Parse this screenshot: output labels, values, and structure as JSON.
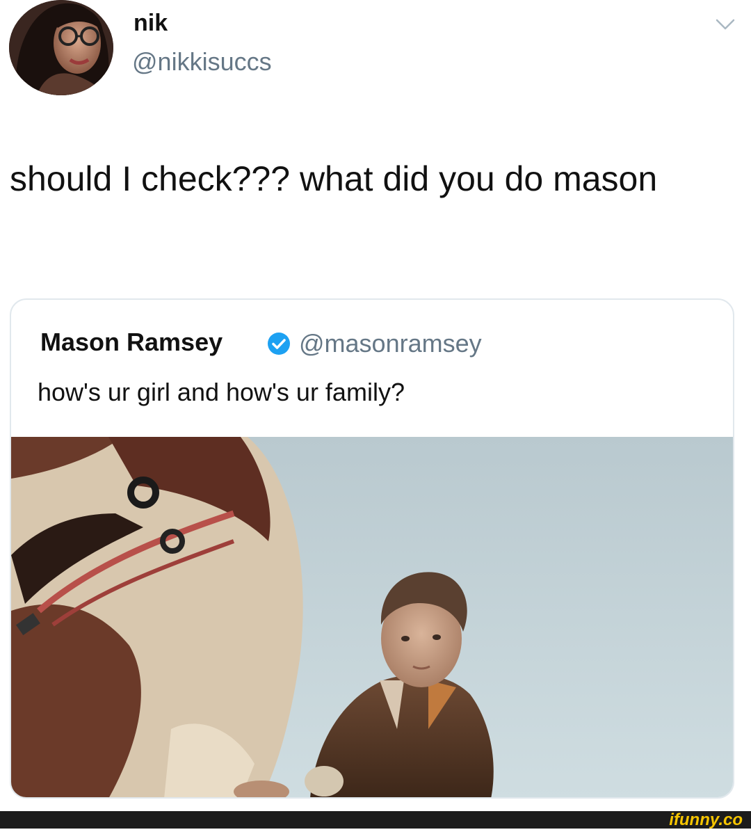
{
  "tweet": {
    "author_name": "nik",
    "author_handle": "@nikkisuccs",
    "text": "should I check??? what did you do mason",
    "menu_icon": "chevron-down-icon"
  },
  "quoted_tweet": {
    "author_name": "Mason Ramsey",
    "verified_icon": "verified-badge-icon",
    "author_handle": "@masonramsey",
    "text": "how's ur girl and how's ur family?"
  },
  "watermark": {
    "text": "ifunny.co",
    "color": "#f6c500"
  },
  "colors": {
    "handle_gray": "#657786",
    "verified_blue": "#1da1f2",
    "quote_border": "#e1e8ed",
    "footer_bar": "#1c1c1c"
  }
}
